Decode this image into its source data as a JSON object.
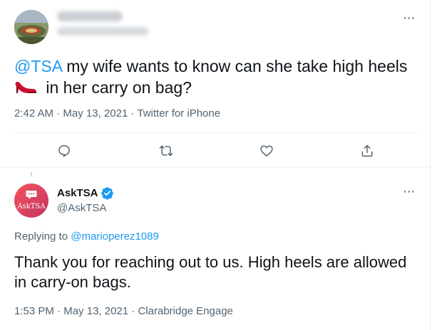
{
  "tweet1": {
    "avatar_icon": "avatar-photo",
    "mention": "@TSA",
    "text_line1": " my wife wants to know can she take high heels",
    "text_line2": " in her carry on bag?",
    "emoji_icon": "high-heel-icon",
    "time": "2:42 AM",
    "dot1": " · ",
    "date": "May 13, 2021",
    "dot2": " · ",
    "source": "Twitter for iPhone",
    "more": "···",
    "actions": [
      "reply-icon",
      "retweet-icon",
      "like-icon",
      "share-icon"
    ]
  },
  "tweet2": {
    "avatar_label": "AskTSA",
    "name": "AskTSA",
    "handle": "@AskTSA",
    "verified_icon": "verified-badge-icon",
    "replying_prefix": "Replying to ",
    "replying_to": "@marioperez1089",
    "text": "Thank you for reaching out to us. High heels are allowed in carry-on bags.",
    "time": "1:53 PM",
    "dot1": " · ",
    "date": "May 13, 2021",
    "dot2": " · ",
    "source": "Clarabridge Engage",
    "more": "···"
  },
  "colors": {
    "accent": "#1d9bf0",
    "muted": "#536471",
    "text": "#0f1419",
    "avatar_gradient_start": "#f2555e",
    "avatar_gradient_end": "#c23262"
  }
}
